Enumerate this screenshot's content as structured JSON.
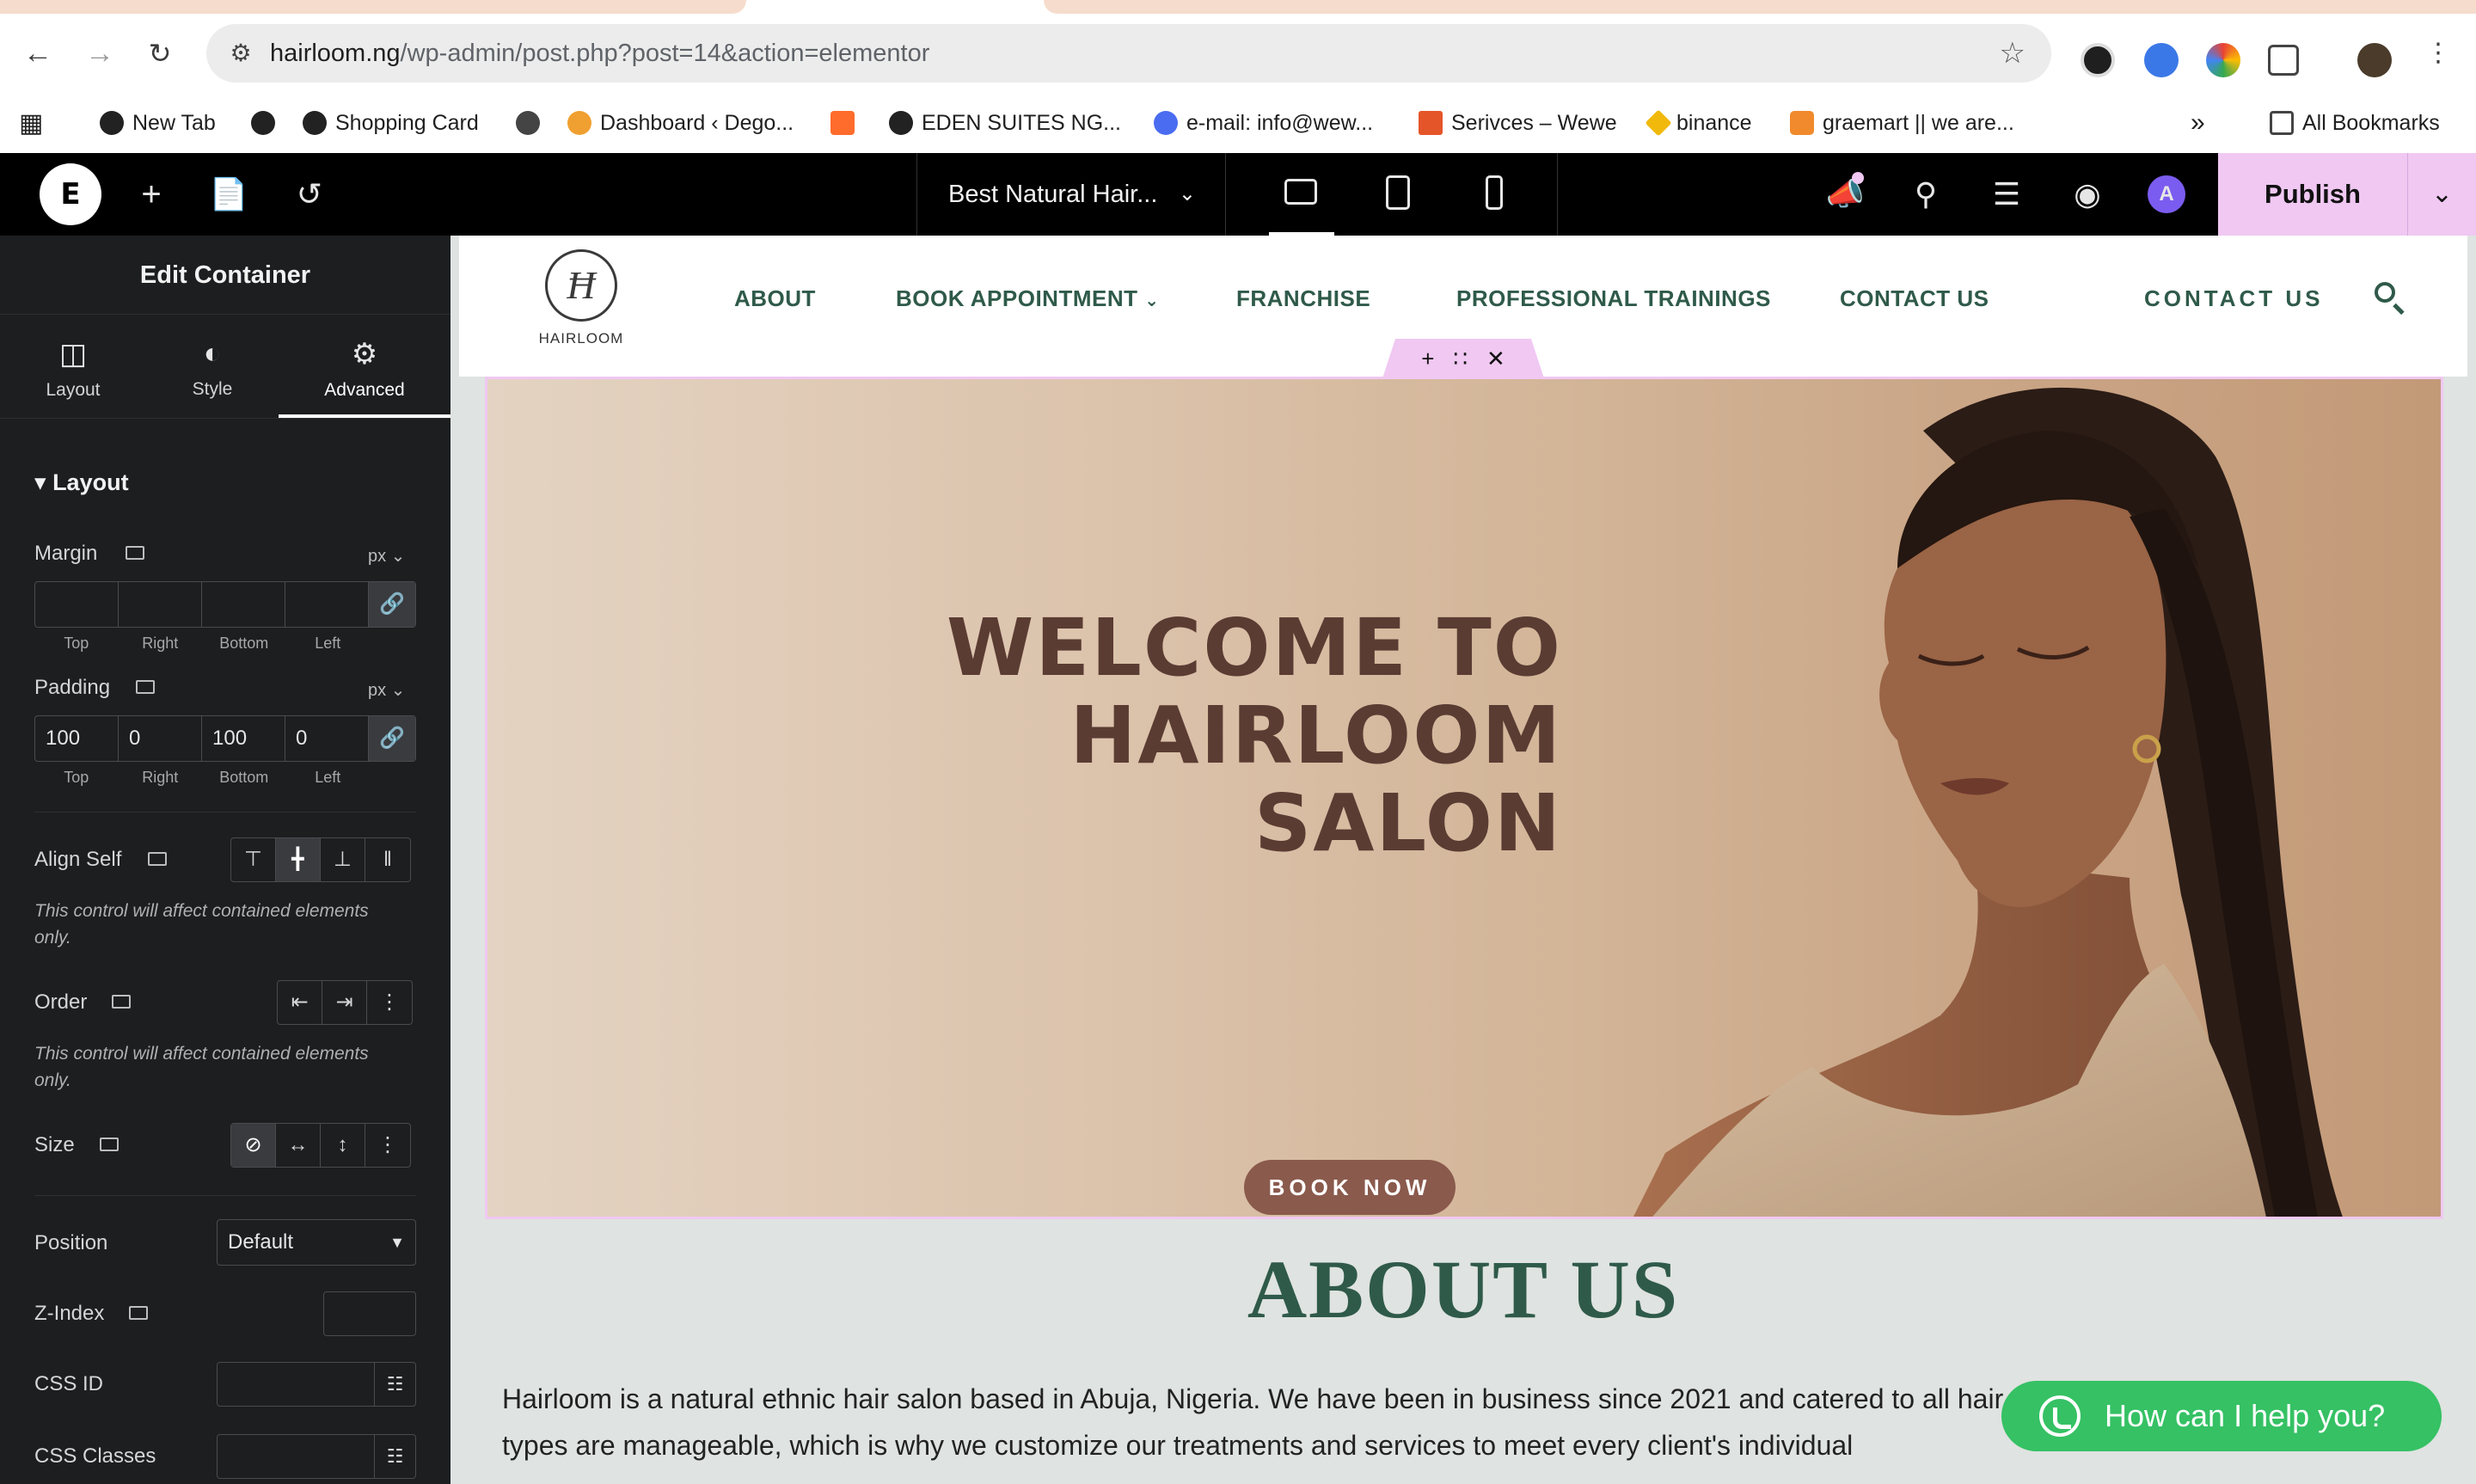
{
  "browser": {
    "url_domain": "hairloom.ng",
    "url_path": "/wp-admin/post.php?post=14&action=elementor",
    "bookmarks": [
      {
        "label": "New Tab"
      },
      {
        "label": ""
      },
      {
        "label": "Shopping Card"
      },
      {
        "label": ""
      },
      {
        "label": "Dashboard ‹ Dego..."
      },
      {
        "label": ""
      },
      {
        "label": "EDEN SUITES NG..."
      },
      {
        "label": "e-mail: info@wew..."
      },
      {
        "label": "Serivces – Wewe"
      },
      {
        "label": "binance"
      },
      {
        "label": "graemart || we are..."
      }
    ],
    "overflow": "»",
    "all_bookmarks": "All Bookmarks"
  },
  "editor": {
    "logo_letter": "E",
    "document_title": "Best Natural Hair...",
    "publish_label": "Publish",
    "avatar_letter": "A"
  },
  "panel": {
    "title": "Edit Container",
    "tabs": [
      {
        "label": "Layout",
        "icon": "layout-icon"
      },
      {
        "label": "Style",
        "icon": "style-icon"
      },
      {
        "label": "Advanced",
        "icon": "gear-icon"
      }
    ],
    "section": "Layout",
    "margin": {
      "label": "Margin",
      "unit": "px",
      "top": "",
      "right": "",
      "bottom": "",
      "left": ""
    },
    "padding": {
      "label": "Padding",
      "unit": "px",
      "top": "100",
      "right": "0",
      "bottom": "100",
      "left": "0"
    },
    "dim_labels": {
      "top": "Top",
      "right": "Right",
      "bottom": "Bottom",
      "left": "Left"
    },
    "align_self_label": "Align Self",
    "align_note": "This control will affect contained elements only.",
    "order_label": "Order",
    "order_note": "This control will affect contained elements only.",
    "size_label": "Size",
    "position_label": "Position",
    "position_value": "Default",
    "zindex_label": "Z-Index",
    "zindex_value": "",
    "css_id_label": "CSS ID",
    "css_classes_label": "CSS Classes"
  },
  "site": {
    "logo_text": "HAIRLOOM",
    "nav": [
      "ABOUT",
      "BOOK APPOINTMENT",
      "FRANCHISE",
      "PROFESSIONAL TRAININGS",
      "CONTACT US"
    ],
    "cta": "CONTACT US",
    "hero_lines": [
      "WELCOME TO",
      "HAIRLOOM",
      "SALON"
    ],
    "book_now": "BOOK NOW",
    "about_title": "ABOUT US",
    "about_text": "Hairloom is a natural ethnic hair salon based in Abuja, Nigeria. We have been in business since 2021 and catered to all hair type. We believe that all hair types are manageable, which is why we customize our treatments and services to meet every client's individual",
    "whatsapp_label": "How can I help you?"
  },
  "colors": {
    "accent": "#f0c8f2",
    "site_green": "#2f5a4a",
    "hero_text": "#5b3c33",
    "book_btn": "#8a5a4d",
    "whatsapp": "#35c164"
  }
}
